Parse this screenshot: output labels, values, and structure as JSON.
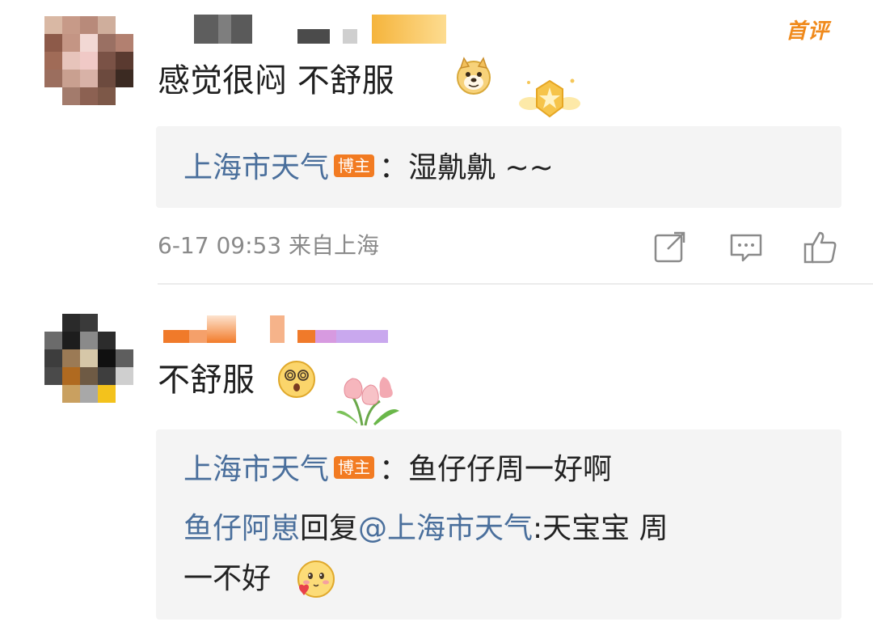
{
  "comments": [
    {
      "text": "感觉很闷  不舒服",
      "tag": "首评",
      "emoji": "doge-emoji",
      "decoration": "crown-badge-icon",
      "reply": {
        "author": "上海市天气",
        "badge": "博主",
        "colon": "：",
        "text": "湿鼽鼽 ~~"
      },
      "meta": "6-17 09:53 来自上海"
    },
    {
      "text": "不舒服",
      "emoji": "dizzy-face-emoji",
      "decoration": "tulip-icon",
      "reply": {
        "author": "上海市天气",
        "badge": "博主",
        "colon": "：",
        "text": "鱼仔仔周一好啊"
      },
      "sub_reply": {
        "author": "鱼仔阿崽",
        "verb": "回复",
        "mention": "@上海市天气",
        "text_line1": ":天宝宝 周",
        "text_line2": "一不好",
        "emoji": "blushing-heart-emoji"
      }
    }
  ],
  "actions": [
    {
      "icon": "share-icon"
    },
    {
      "icon": "comment-icon"
    },
    {
      "icon": "like-icon"
    }
  ],
  "colors": {
    "link_blue": "#4a6f9c",
    "badge_orange": "#f27b22",
    "reply_bg": "#f4f4f4",
    "meta_gray": "#8a8a8a"
  }
}
